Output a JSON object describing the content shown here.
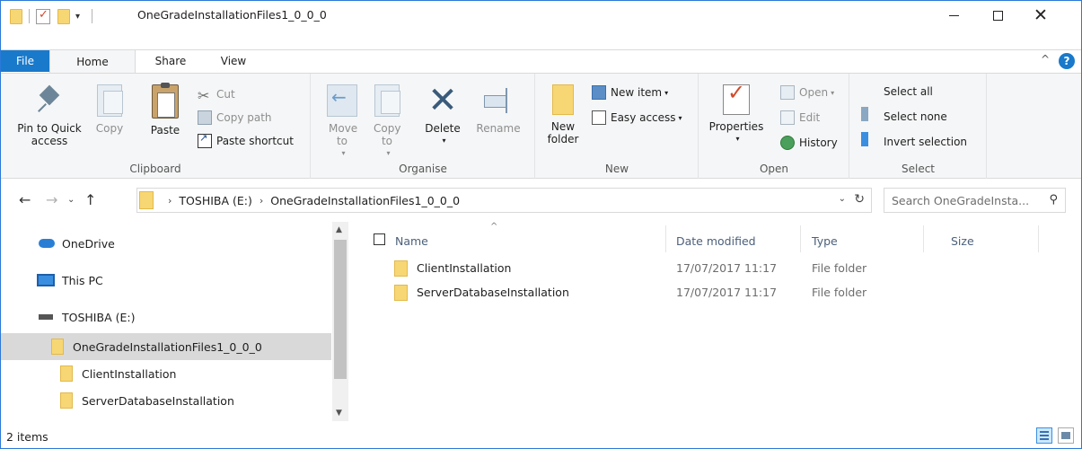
{
  "window": {
    "title": "OneGradeInstallationFiles1_0_0_0",
    "qat_dropdown": "▾",
    "controls": {
      "minimize": "—",
      "maximize": "☐",
      "close": "✕"
    }
  },
  "tabs": [
    {
      "label": "File"
    },
    {
      "label": "Home"
    },
    {
      "label": "Share"
    },
    {
      "label": "View"
    }
  ],
  "ribbon_controls": {
    "collapse": "^",
    "help": "?"
  },
  "ribbon": {
    "clipboard": {
      "label": "Clipboard",
      "pin": "Pin to Quick access",
      "copy": "Copy",
      "paste": "Paste",
      "cut": "Cut",
      "copy_path": "Copy path",
      "paste_shortcut": "Paste shortcut"
    },
    "organise": {
      "label": "Organise",
      "move_to": "Move to",
      "copy_to": "Copy to",
      "delete": "Delete",
      "rename": "Rename"
    },
    "new": {
      "label": "New",
      "new_folder": "New folder",
      "new_item": "New item",
      "easy_access": "Easy access"
    },
    "open": {
      "label": "Open",
      "properties": "Properties",
      "open": "Open",
      "edit": "Edit",
      "history": "History"
    },
    "select": {
      "label": "Select",
      "select_all": "Select all",
      "select_none": "Select none",
      "invert_selection": "Invert selection"
    }
  },
  "address": {
    "back": "←",
    "forward": "→",
    "recent": "⌄",
    "up": "↑",
    "crumbs": [
      "TOSHIBA (E:)",
      "OneGradeInstallationFiles1_0_0_0"
    ],
    "separator": "›",
    "dropdown": "⌄",
    "refresh": "↻",
    "search_placeholder": "Search OneGradeInsta..."
  },
  "nav_pane": {
    "items": [
      {
        "label": "OneDrive",
        "icon": "onedrive-icon"
      },
      {
        "label": "This PC",
        "icon": "computer-icon"
      },
      {
        "label": "TOSHIBA (E:)",
        "icon": "drive-icon"
      },
      {
        "label": "OneGradeInstallationFiles1_0_0_0",
        "icon": "folder-icon",
        "selected": true
      },
      {
        "label": "ClientInstallation",
        "icon": "folder-icon"
      },
      {
        "label": "ServerDatabaseInstallation",
        "icon": "folder-icon"
      }
    ]
  },
  "file_list": {
    "columns": {
      "name": "Name",
      "date": "Date modified",
      "type": "Type",
      "size": "Size"
    },
    "sort_indicator": "^",
    "rows": [
      {
        "name": "ClientInstallation",
        "date": "17/07/2017 11:17",
        "type": "File folder",
        "size": ""
      },
      {
        "name": "ServerDatabaseInstallation",
        "date": "17/07/2017 11:17",
        "type": "File folder",
        "size": ""
      }
    ]
  },
  "status": {
    "item_count": "2 items"
  },
  "colors": {
    "accent": "#1979ca",
    "selection": "#cce8ff",
    "folder": "#f7d774"
  }
}
